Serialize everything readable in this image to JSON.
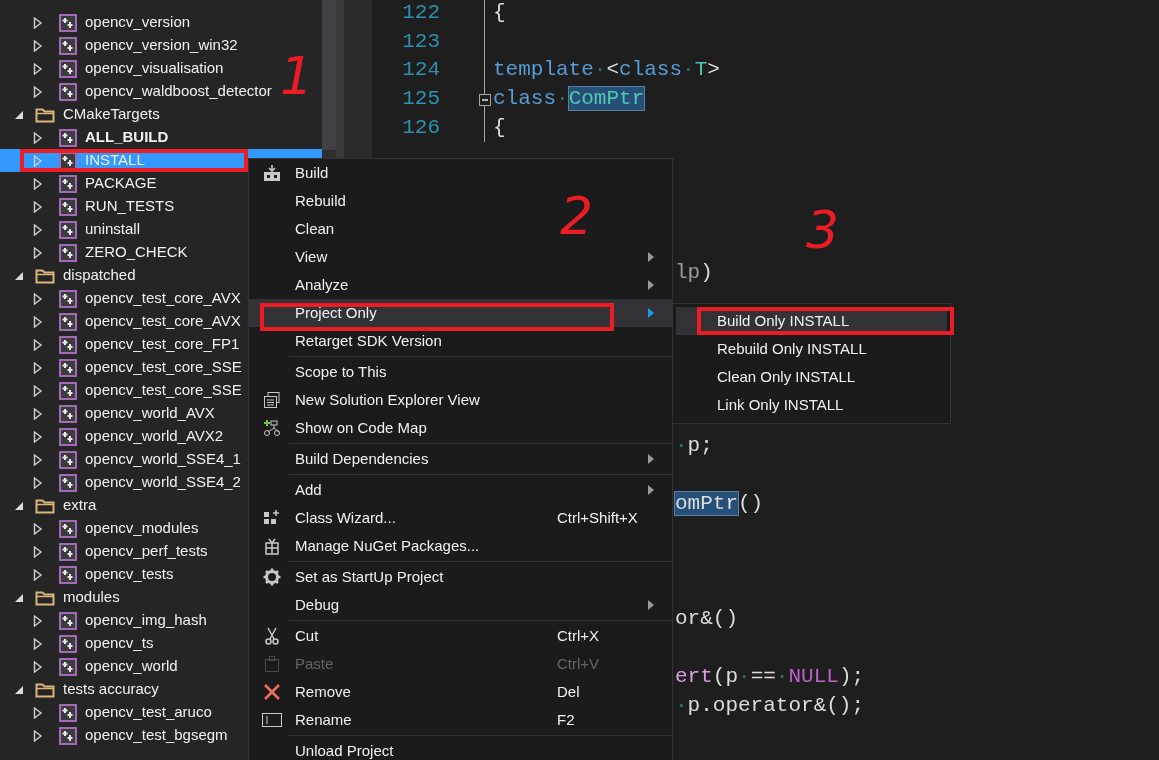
{
  "solution_explorer": {
    "items": [
      {
        "kind": "project",
        "label": "opencv_version",
        "expanded": false,
        "selected": false,
        "startup": false
      },
      {
        "kind": "project",
        "label": "opencv_version_win32",
        "expanded": false,
        "selected": false,
        "startup": false
      },
      {
        "kind": "project",
        "label": "opencv_visualisation",
        "expanded": false,
        "selected": false,
        "startup": false
      },
      {
        "kind": "project",
        "label": "opencv_waldboost_detector",
        "expanded": false,
        "selected": false,
        "startup": false
      },
      {
        "kind": "folder",
        "label": "CMakeTargets",
        "expanded": true,
        "selected": false,
        "children": [
          {
            "kind": "project",
            "label": "ALL_BUILD",
            "expanded": false,
            "selected": false,
            "startup": true
          },
          {
            "kind": "project",
            "label": "INSTALL",
            "expanded": false,
            "selected": true,
            "startup": false
          },
          {
            "kind": "project",
            "label": "PACKAGE",
            "expanded": false,
            "selected": false,
            "startup": false
          },
          {
            "kind": "project",
            "label": "RUN_TESTS",
            "expanded": false,
            "selected": false,
            "startup": false
          },
          {
            "kind": "project",
            "label": "uninstall",
            "expanded": false,
            "selected": false,
            "startup": false
          },
          {
            "kind": "project",
            "label": "ZERO_CHECK",
            "expanded": false,
            "selected": false,
            "startup": false
          }
        ]
      },
      {
        "kind": "folder",
        "label": "dispatched",
        "expanded": true,
        "selected": false,
        "children": [
          {
            "kind": "project",
            "label": "opencv_test_core_AVX",
            "expanded": false,
            "selected": false,
            "startup": false
          },
          {
            "kind": "project",
            "label": "opencv_test_core_AVX",
            "expanded": false,
            "selected": false,
            "startup": false
          },
          {
            "kind": "project",
            "label": "opencv_test_core_FP1",
            "expanded": false,
            "selected": false,
            "startup": false
          },
          {
            "kind": "project",
            "label": "opencv_test_core_SSE",
            "expanded": false,
            "selected": false,
            "startup": false
          },
          {
            "kind": "project",
            "label": "opencv_test_core_SSE",
            "expanded": false,
            "selected": false,
            "startup": false
          },
          {
            "kind": "project",
            "label": "opencv_world_AVX",
            "expanded": false,
            "selected": false,
            "startup": false
          },
          {
            "kind": "project",
            "label": "opencv_world_AVX2",
            "expanded": false,
            "selected": false,
            "startup": false
          },
          {
            "kind": "project",
            "label": "opencv_world_SSE4_1",
            "expanded": false,
            "selected": false,
            "startup": false
          },
          {
            "kind": "project",
            "label": "opencv_world_SSE4_2",
            "expanded": false,
            "selected": false,
            "startup": false
          }
        ]
      },
      {
        "kind": "folder",
        "label": "extra",
        "expanded": true,
        "selected": false,
        "children": [
          {
            "kind": "project",
            "label": "opencv_modules",
            "expanded": false,
            "selected": false,
            "startup": false
          },
          {
            "kind": "project",
            "label": "opencv_perf_tests",
            "expanded": false,
            "selected": false,
            "startup": false
          },
          {
            "kind": "project",
            "label": "opencv_tests",
            "expanded": false,
            "selected": false,
            "startup": false
          }
        ]
      },
      {
        "kind": "folder",
        "label": "modules",
        "expanded": true,
        "selected": false,
        "children": [
          {
            "kind": "project",
            "label": "opencv_img_hash",
            "expanded": false,
            "selected": false,
            "startup": false
          },
          {
            "kind": "project",
            "label": "opencv_ts",
            "expanded": false,
            "selected": false,
            "startup": false
          },
          {
            "kind": "project",
            "label": "opencv_world",
            "expanded": false,
            "selected": false,
            "startup": false
          }
        ]
      },
      {
        "kind": "folder",
        "label": "tests accuracy",
        "expanded": true,
        "selected": false,
        "children": [
          {
            "kind": "project",
            "label": "opencv_test_aruco",
            "expanded": false,
            "selected": false,
            "startup": false
          },
          {
            "kind": "project",
            "label": "opencv_test_bgsegm",
            "expanded": false,
            "selected": false,
            "startup": false
          }
        ]
      }
    ]
  },
  "editor": {
    "rows": [
      {
        "kind": "numbered",
        "number": "122",
        "fold_marker": false,
        "tokens": [
          {
            "text": "{",
            "kind": "plain"
          }
        ]
      },
      {
        "kind": "numbered",
        "number": "123",
        "fold_marker": false
      },
      {
        "kind": "numbered",
        "number": "124",
        "fold_marker": false,
        "tokens": [
          {
            "text": "template",
            "kind": "keyword"
          },
          {
            "text": "·",
            "kind": "space"
          },
          {
            "text": "<",
            "kind": "plain"
          },
          {
            "text": "class",
            "kind": "keyword"
          },
          {
            "text": "·",
            "kind": "space"
          },
          {
            "text": "T",
            "kind": "type"
          },
          {
            "text": ">",
            "kind": "plain"
          }
        ]
      },
      {
        "kind": "numbered",
        "number": "125",
        "fold_marker": true,
        "tokens": [
          {
            "text": "class",
            "kind": "keyword"
          },
          {
            "text": "·",
            "kind": "space"
          },
          {
            "text": "ComPtr",
            "kind": "type_highlighted"
          }
        ]
      },
      {
        "kind": "numbered",
        "number": "126",
        "fold_marker": false,
        "tokens": [
          {
            "text": "{",
            "kind": "plain"
          }
        ]
      },
      {
        "kind": "hidden"
      },
      {
        "kind": "hidden"
      },
      {
        "kind": "hidden"
      },
      {
        "kind": "hidden"
      },
      {
        "kind": "fragment",
        "tokens": [
          {
            "text": "lp",
            "kind": "param"
          },
          {
            "text": ")",
            "kind": "plain"
          }
        ]
      },
      {
        "kind": "hidden"
      },
      {
        "kind": "hidden"
      },
      {
        "kind": "hidden"
      },
      {
        "kind": "hidden"
      },
      {
        "kind": "hidden"
      },
      {
        "kind": "fragment",
        "tokens": [
          {
            "text": "·",
            "kind": "space"
          },
          {
            "text": "p;",
            "kind": "plain"
          }
        ]
      },
      {
        "kind": "hidden"
      },
      {
        "kind": "fragment",
        "tokens": [
          {
            "text": "omPtr",
            "kind": "plain_highlighted"
          },
          {
            "text": "()",
            "kind": "plain"
          }
        ]
      },
      {
        "kind": "hidden"
      },
      {
        "kind": "hidden"
      },
      {
        "kind": "hidden"
      },
      {
        "kind": "fragment",
        "tokens": [
          {
            "text": "or&()",
            "kind": "plain"
          }
        ]
      },
      {
        "kind": "hidden"
      },
      {
        "kind": "fragment",
        "tokens": [
          {
            "text": "ert",
            "kind": "function"
          },
          {
            "text": "(p",
            "kind": "plain"
          },
          {
            "text": "·",
            "kind": "space"
          },
          {
            "text": "==",
            "kind": "plain"
          },
          {
            "text": "·",
            "kind": "space"
          },
          {
            "text": "NULL",
            "kind": "macro"
          },
          {
            "text": ");",
            "kind": "plain"
          }
        ]
      },
      {
        "kind": "fragment",
        "tokens": [
          {
            "text": "·",
            "kind": "space"
          },
          {
            "text": "p.operator&();",
            "kind": "plain"
          }
        ]
      }
    ]
  },
  "context_menu": {
    "items": [
      {
        "kind": "item",
        "label": "Build",
        "has_submenu": false,
        "selected": false,
        "disabled": false
      },
      {
        "kind": "item",
        "label": "Rebuild",
        "has_submenu": false,
        "selected": false,
        "disabled": false
      },
      {
        "kind": "item",
        "label": "Clean",
        "has_submenu": false,
        "selected": false,
        "disabled": false
      },
      {
        "kind": "item",
        "label": "View",
        "has_submenu": true,
        "selected": false,
        "disabled": false
      },
      {
        "kind": "item",
        "label": "Analyze",
        "has_submenu": true,
        "selected": false,
        "disabled": false
      },
      {
        "kind": "item",
        "label": "Project Only",
        "has_submenu": true,
        "selected": true,
        "disabled": false
      },
      {
        "kind": "item",
        "label": "Retarget SDK Version",
        "has_submenu": false,
        "selected": false,
        "disabled": false
      },
      {
        "kind": "separator"
      },
      {
        "kind": "item",
        "label": "Scope to This",
        "has_submenu": false,
        "selected": false,
        "disabled": false
      },
      {
        "kind": "item",
        "label": "New Solution Explorer View",
        "has_submenu": false,
        "selected": false,
        "disabled": false
      },
      {
        "kind": "item",
        "label": "Show on Code Map",
        "has_submenu": false,
        "selected": false,
        "disabled": false
      },
      {
        "kind": "separator"
      },
      {
        "kind": "item",
        "label": "Build Dependencies",
        "has_submenu": true,
        "selected": false,
        "disabled": false
      },
      {
        "kind": "separator"
      },
      {
        "kind": "item",
        "label": "Add",
        "has_submenu": true,
        "selected": false,
        "disabled": false
      },
      {
        "kind": "item",
        "label": "Class Wizard...",
        "shortcut": "Ctrl+Shift+X",
        "has_submenu": false,
        "selected": false,
        "disabled": false
      },
      {
        "kind": "item",
        "label": "Manage NuGet Packages...",
        "has_submenu": false,
        "selected": false,
        "disabled": false
      },
      {
        "kind": "separator"
      },
      {
        "kind": "item",
        "label": "Set as StartUp Project",
        "has_submenu": false,
        "selected": false,
        "disabled": false
      },
      {
        "kind": "item",
        "label": "Debug",
        "has_submenu": true,
        "selected": false,
        "disabled": false
      },
      {
        "kind": "separator"
      },
      {
        "kind": "item",
        "label": "Cut",
        "shortcut": "Ctrl+X",
        "has_submenu": false,
        "selected": false,
        "disabled": false
      },
      {
        "kind": "item",
        "label": "Paste",
        "shortcut": "Ctrl+V",
        "has_submenu": false,
        "selected": false,
        "disabled": true
      },
      {
        "kind": "item",
        "label": "Remove",
        "shortcut": "Del",
        "has_submenu": false,
        "selected": false,
        "disabled": false
      },
      {
        "kind": "item",
        "label": "Rename",
        "shortcut": "F2",
        "has_submenu": false,
        "selected": false,
        "disabled": false
      },
      {
        "kind": "separator"
      },
      {
        "kind": "item",
        "label": "Unload Project",
        "has_submenu": false,
        "selected": false,
        "disabled": false
      }
    ]
  },
  "submenu": {
    "items": [
      {
        "label": "Build Only INSTALL",
        "selected": true
      },
      {
        "label": "Rebuild Only INSTALL",
        "selected": false
      },
      {
        "label": "Clean Only INSTALL",
        "selected": false
      },
      {
        "label": "Link Only INSTALL",
        "selected": false
      }
    ]
  },
  "annotations": [
    {
      "kind": "frame"
    },
    {
      "kind": "frame"
    },
    {
      "kind": "frame"
    },
    {
      "kind": "number",
      "text": "1"
    },
    {
      "kind": "number",
      "text": "2"
    },
    {
      "kind": "number",
      "text": "3"
    }
  ]
}
